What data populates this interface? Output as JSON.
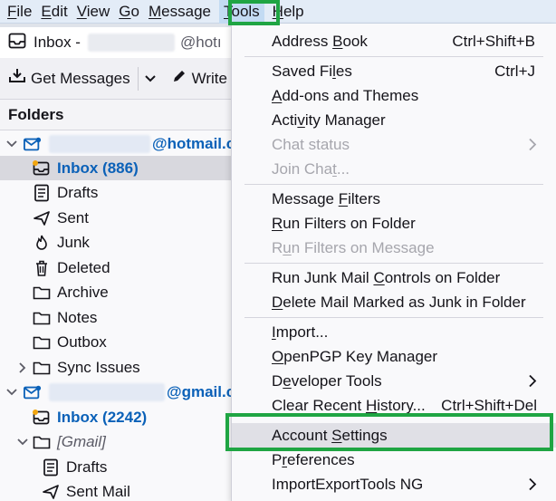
{
  "menubar": {
    "items": [
      {
        "label": "File",
        "u": "F",
        "rest": "ile"
      },
      {
        "label": "Edit",
        "u": "E",
        "rest": "dit"
      },
      {
        "label": "View",
        "u": "V",
        "rest": "iew"
      },
      {
        "label": "Go",
        "u": "G",
        "rest": "o"
      },
      {
        "label": "Message",
        "u": "M",
        "rest": "essage"
      },
      {
        "label": "Tools",
        "u": "T",
        "rest": "ools"
      },
      {
        "label": "Help",
        "u": "H",
        "rest": "elp"
      }
    ],
    "active": "Tools"
  },
  "tab": {
    "title_prefix": "Inbox -",
    "title_suffix": "@hotı"
  },
  "toolbar": {
    "get_messages": "Get Messages",
    "write": "Write"
  },
  "folders_pane": {
    "title": "Folders",
    "account1_domain": "@hotmail.c",
    "account2_domain": "@gmail.c",
    "rows": {
      "inbox1": "Inbox (886)",
      "drafts1": "Drafts",
      "sent1": "Sent",
      "junk1": "Junk",
      "deleted1": "Deleted",
      "archive1": "Archive",
      "notes1": "Notes",
      "outbox1": "Outbox",
      "sync1": "Sync Issues",
      "inbox2": "Inbox (2242)",
      "gmail2": "[Gmail]",
      "drafts2": "Drafts",
      "sent2": "Sent Mail"
    }
  },
  "tools_menu": {
    "address_book": {
      "label": "Address Book",
      "shortcut": "Ctrl+Shift+B"
    },
    "saved_files": {
      "label": "Saved Files",
      "shortcut": "Ctrl+J"
    },
    "addons": {
      "label": "Add-ons and Themes"
    },
    "activity": {
      "label": "Activity Manager"
    },
    "chat_status": {
      "label": "Chat status"
    },
    "join_chat": {
      "label": "Join Chat..."
    },
    "message_filters": {
      "label": "Message Filters"
    },
    "run_filters_folder": {
      "label": "Run Filters on Folder"
    },
    "run_filters_message": {
      "label": "Run Filters on Message"
    },
    "run_junk": {
      "label": "Run Junk Mail Controls on Folder"
    },
    "delete_junk": {
      "label": "Delete Mail Marked as Junk in Folder"
    },
    "import": {
      "label": "Import..."
    },
    "openpgp": {
      "label": "OpenPGP Key Manager"
    },
    "developer": {
      "label": "Developer Tools"
    },
    "clear_history": {
      "label": "Clear Recent History...",
      "shortcut": "Ctrl+Shift+Del"
    },
    "account_settings": {
      "label": "Account Settings"
    },
    "preferences": {
      "label": "Preferences"
    },
    "importexport": {
      "label": "ImportExportTools NG"
    }
  },
  "colors": {
    "highlight_box": "#1fa543",
    "accent_blue": "#0b61b8",
    "menubar_bg": "#e3ecf7"
  }
}
